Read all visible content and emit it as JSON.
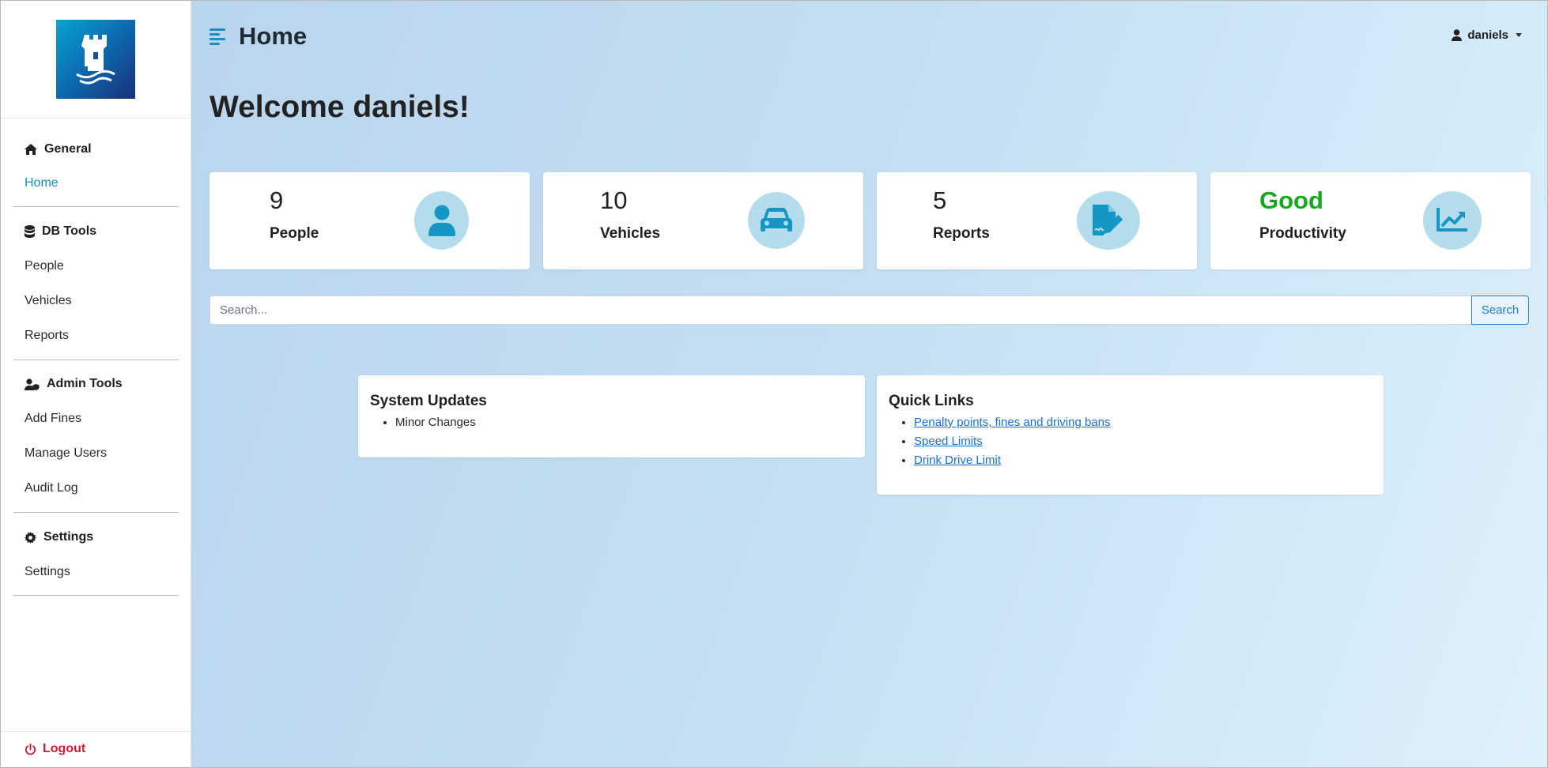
{
  "sidebar": {
    "sections": [
      {
        "title": "General",
        "icon": "home-icon",
        "items": [
          {
            "label": "Home",
            "active": true
          }
        ]
      },
      {
        "title": "DB Tools",
        "icon": "database-icon",
        "items": [
          {
            "label": "People"
          },
          {
            "label": "Vehicles"
          },
          {
            "label": "Reports"
          }
        ]
      },
      {
        "title": "Admin Tools",
        "icon": "user-shield-icon",
        "items": [
          {
            "label": "Add Fines"
          },
          {
            "label": "Manage Users"
          },
          {
            "label": "Audit Log"
          }
        ]
      },
      {
        "title": "Settings",
        "icon": "gear-icon",
        "items": [
          {
            "label": "Settings"
          }
        ]
      }
    ],
    "logout_label": "Logout"
  },
  "header": {
    "title": "Home",
    "username": "daniels"
  },
  "welcome": "Welcome daniels!",
  "stats": [
    {
      "value": "9",
      "label": "People",
      "icon": "person-icon"
    },
    {
      "value": "10",
      "label": "Vehicles",
      "icon": "car-icon"
    },
    {
      "value": "5",
      "label": "Reports",
      "icon": "report-edit-icon"
    },
    {
      "value": "Good",
      "label": "Productivity",
      "icon": "chart-line-icon"
    }
  ],
  "search": {
    "placeholder": "Search...",
    "button_label": "Search"
  },
  "system_updates": {
    "title": "System Updates",
    "items": [
      "Minor Changes"
    ]
  },
  "quick_links": {
    "title": "Quick Links",
    "links": [
      "Penalty points, fines and driving bans",
      "Speed Limits",
      "Drink Drive Limit"
    ]
  },
  "colors": {
    "accent": "#178fb8",
    "good": "#18a81f",
    "logout": "#d11b35",
    "link": "#1a6fd1"
  }
}
